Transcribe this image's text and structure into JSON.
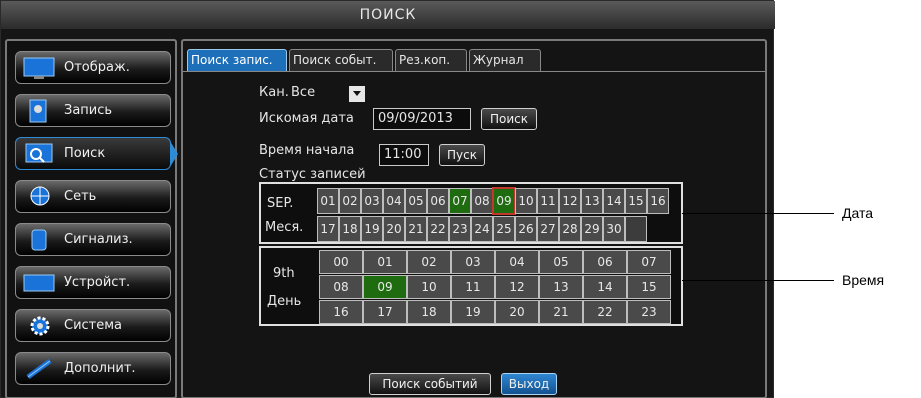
{
  "window": {
    "title": "ПОИСК"
  },
  "sidebar": {
    "items": [
      {
        "label": "Отображ.",
        "icon": "monitor-icon",
        "active": false
      },
      {
        "label": "Запись",
        "icon": "record-icon",
        "active": false
      },
      {
        "label": "Поиск",
        "icon": "search-icon",
        "active": true
      },
      {
        "label": "Сеть",
        "icon": "network-icon",
        "active": false
      },
      {
        "label": "Сигнализ.",
        "icon": "alarm-icon",
        "active": false
      },
      {
        "label": "Устройст.",
        "icon": "device-icon",
        "active": false
      },
      {
        "label": "Система",
        "icon": "gear-icon",
        "active": false
      },
      {
        "label": "Дополнит.",
        "icon": "tools-icon",
        "active": false
      }
    ]
  },
  "tabs": [
    {
      "label": "Поиск запис.",
      "active": true
    },
    {
      "label": "Поиск событ.",
      "active": false
    },
    {
      "label": "Рез.коп.",
      "active": false
    },
    {
      "label": "Журнал",
      "active": false
    }
  ],
  "form": {
    "channel_label": "Кан.",
    "channel_value": "Все",
    "date_label": "Искомая дата",
    "date_value": "09/09/2013",
    "search_button": "Поиск",
    "start_time_label": "Время начала",
    "start_time_value": "11:00",
    "start_button": "Пуск",
    "status_label": "Статус записей"
  },
  "date_grid": {
    "month_label": "SEP.",
    "month_caption": "Меся.",
    "days": [
      "01",
      "02",
      "03",
      "04",
      "05",
      "06",
      "07",
      "08",
      "09",
      "10",
      "11",
      "12",
      "13",
      "14",
      "15",
      "16",
      "17",
      "18",
      "19",
      "20",
      "21",
      "22",
      "23",
      "24",
      "25",
      "26",
      "27",
      "28",
      "29",
      "30",
      ""
    ],
    "recorded": [
      "07",
      "09"
    ],
    "selected": "09"
  },
  "time_grid": {
    "day_label": "9th",
    "day_caption": "День",
    "hours": [
      "00",
      "01",
      "02",
      "03",
      "04",
      "05",
      "06",
      "07",
      "08",
      "09",
      "10",
      "11",
      "12",
      "13",
      "14",
      "15",
      "16",
      "17",
      "18",
      "19",
      "20",
      "21",
      "22",
      "23"
    ],
    "recorded": [
      "09"
    ]
  },
  "bottom": {
    "event_search_button": "Поиск событий",
    "exit_button": "Выход"
  },
  "annotations": {
    "date": "Дата",
    "time": "Время"
  },
  "colors": {
    "accent": "#1c6fb8",
    "recorded": "#1e6b10",
    "highlight_frame": "#c0392b"
  }
}
